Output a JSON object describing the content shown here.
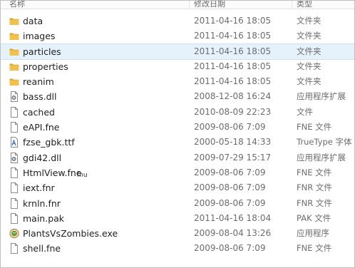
{
  "header": {
    "name_label": "名称",
    "date_label": "修改日期",
    "type_label": "类型"
  },
  "files": [
    {
      "name": "data",
      "date": "2011-04-16 18:05",
      "type": "文件夹",
      "icon": "folder-icon"
    },
    {
      "name": "images",
      "date": "2011-04-16 18:05",
      "type": "文件夹",
      "icon": "folder-icon"
    },
    {
      "name": "particles",
      "date": "2011-04-16 18:05",
      "type": "文件夹",
      "icon": "folder-icon",
      "selected": true
    },
    {
      "name": "properties",
      "date": "2011-04-16 18:05",
      "type": "文件夹",
      "icon": "folder-icon"
    },
    {
      "name": "reanim",
      "date": "2011-04-16 18:05",
      "type": "文件夹",
      "icon": "folder-icon"
    },
    {
      "name": "bass.dll",
      "date": "2008-12-08 16:24",
      "type": "应用程序扩展",
      "icon": "dll-icon"
    },
    {
      "name": "cached",
      "date": "2010-08-09 22:23",
      "type": "文件",
      "icon": "file-icon"
    },
    {
      "name": "eAPI.fne",
      "date": "2009-08-06 7:09",
      "type": "FNE 文件",
      "icon": "file-icon"
    },
    {
      "name": "fzse_gbk.ttf",
      "date": "2000-05-18 14:33",
      "type": "TrueType 字体",
      "icon": "font-icon"
    },
    {
      "name": "gdi42.dll",
      "date": "2009-07-29 15:17",
      "type": "应用程序扩展",
      "icon": "dll-icon"
    },
    {
      "name": "HtmlView.fne",
      "date": "2009-08-06 7:09",
      "type": "FNE 文件",
      "icon": "file-icon"
    },
    {
      "name": "iext.fnr",
      "date": "2009-08-06 7:09",
      "type": "FNR 文件",
      "icon": "file-icon"
    },
    {
      "name": "krnln.fnr",
      "date": "2009-08-06 7:09",
      "type": "FNR 文件",
      "icon": "file-icon"
    },
    {
      "name": "main.pak",
      "date": "2011-04-16 18:04",
      "type": "PAK 文件",
      "icon": "file-icon"
    },
    {
      "name": "PlantsVsZombies.exe",
      "date": "2009-08-04 13:26",
      "type": "应用程序",
      "icon": "exe-icon"
    },
    {
      "name": "shell.fne",
      "date": "2009-08-06 7:09",
      "type": "FNE 文件",
      "icon": "file-icon"
    }
  ],
  "artifact_text": "fnu",
  "colors": {
    "folder": "#f0c24d",
    "folder_dark": "#d9a324",
    "selection": "#e5f1fb",
    "secondary_text": "#6d6d6d"
  }
}
